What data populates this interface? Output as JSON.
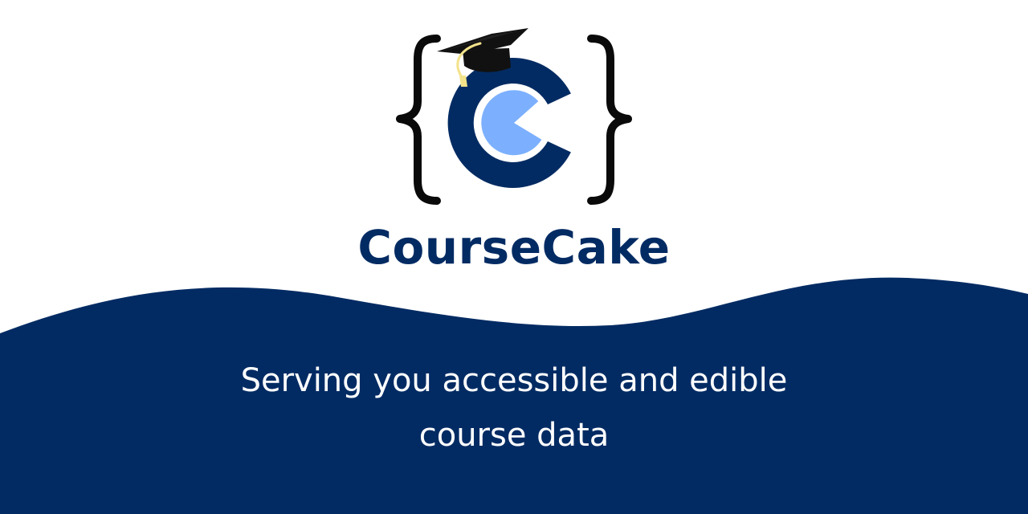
{
  "brand": {
    "name": "CourseCake",
    "colors": {
      "navy": "#032b63",
      "light_blue": "#7cb0fe",
      "white": "#ffffff",
      "bracket": "#0a0a0a",
      "cap": "#111111",
      "tassel": "#f3e38a"
    },
    "logo_icon": "graduation-cap-c-logo-icon"
  },
  "tagline": {
    "line1": "Serving you accessible and edible",
    "line2": "course data"
  }
}
